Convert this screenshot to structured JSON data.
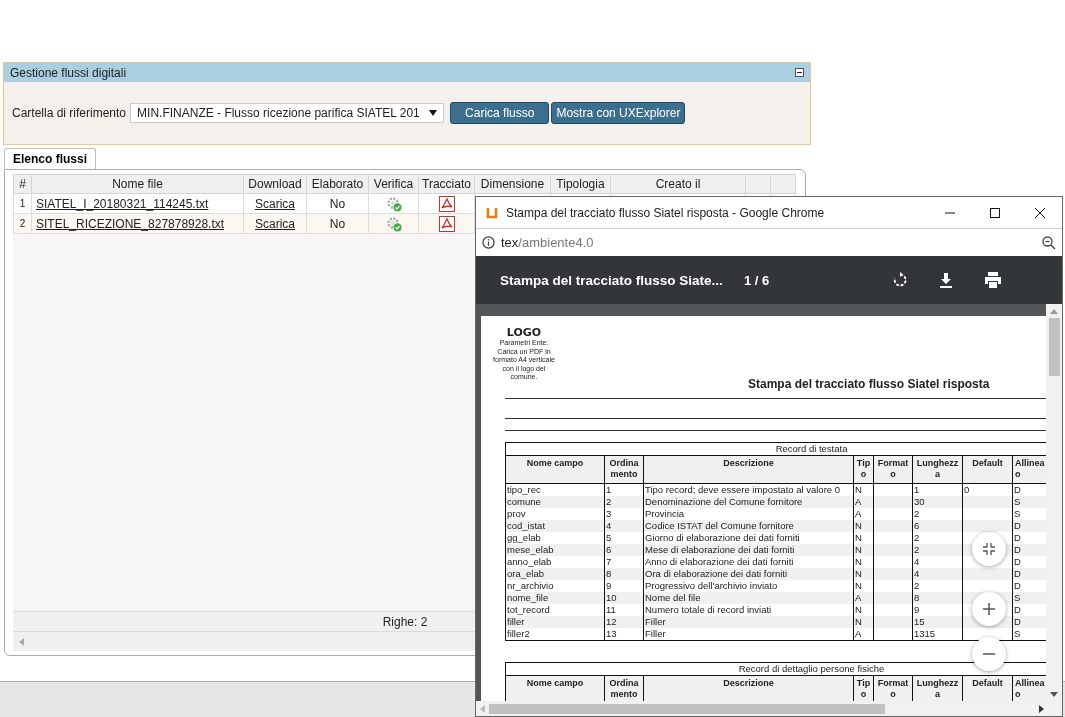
{
  "panel": {
    "title": "Gestione flussi digitali",
    "folder_label": "Cartella di riferimento",
    "folder_value": "MIN.FINANZE - Flusso ricezione parifica SIATEL 201",
    "buttons": [
      "Carica flusso",
      "Mostra con UXExplorer"
    ]
  },
  "tabs": [
    {
      "label": "Elenco flussi",
      "selected": true
    }
  ],
  "grid": {
    "columns": [
      "#",
      "Nome file",
      "Download",
      "Elaborato",
      "Verifica",
      "Tracciato",
      "Dimensione",
      "Tipologia",
      "Creato il"
    ],
    "rows": [
      {
        "number": "1",
        "file": "SIATEL_I_20180321_114245.txt",
        "download": "Scarica",
        "elaborato": "No"
      },
      {
        "number": "2",
        "file": "SITEL_RICEZIONE_827878928.txt",
        "download": "Scarica",
        "elaborato": "No"
      }
    ],
    "footer": "Righe: 2"
  },
  "popup": {
    "title": "Stampa del tracciato flusso Siatel risposta - Google Chrome",
    "url_host": "tex",
    "url_path": "/ambiente4.0",
    "pdf_title": "Stampa del tracciato flusso Siate...",
    "pages": "1 / 6",
    "document": {
      "logo": "LOGO",
      "logo_note": "Parametri Ente: Carica un PDF in formato A4 verticale con il logo del comune.",
      "title": "Stampa del tracciato flusso Siatel risposta",
      "tables": [
        {
          "caption": "Record di testata",
          "columns": [
            {
              "lines": [
                "Nome campo"
              ]
            },
            {
              "lines": [
                "Ordina",
                "mento"
              ]
            },
            {
              "lines": [
                "Descrizione"
              ]
            },
            {
              "lines": [
                "Tip",
                "o"
              ]
            },
            {
              "lines": [
                "Format",
                "o"
              ]
            },
            {
              "lines": [
                "Lunghezz",
                "a"
              ]
            },
            {
              "lines": [
                "Default"
              ]
            },
            {
              "lines": [
                "Allinea",
                "o"
              ]
            }
          ],
          "rows": [
            [
              "tipo_rec",
              "1",
              "Tipo record; deve essere impostato al valore 0",
              "N",
              "",
              "1",
              "0",
              "D"
            ],
            [
              "comune",
              "2",
              "Denominazione del Comune fornitore",
              "A",
              "",
              "30",
              "",
              "S"
            ],
            [
              "prov",
              "3",
              "Provincia",
              "A",
              "",
              "2",
              "",
              "S"
            ],
            [
              "cod_istat",
              "4",
              "Codice ISTAT del Comune fornitore",
              "N",
              "",
              "6",
              "",
              "D"
            ],
            [
              "gg_elab",
              "5",
              "Giorno di elaborazione dei dati forniti",
              "N",
              "",
              "2",
              "",
              "D"
            ],
            [
              "mese_elab",
              "6",
              "Mese di elaborazione dei dati forniti",
              "N",
              "",
              "2",
              "",
              "D"
            ],
            [
              "anno_elab",
              "7",
              "Anno di elaborazione dei dati forniti",
              "N",
              "",
              "4",
              "",
              "D"
            ],
            [
              "ora_elab",
              "8",
              "Ora di elaborazione dei dati forniti",
              "N",
              "",
              "4",
              "",
              "D"
            ],
            [
              "nr_archivio",
              "9",
              "Progressivo dell'archivio inviato",
              "N",
              "",
              "2",
              "",
              "D"
            ],
            [
              "nome_file",
              "10",
              "Nome del file",
              "A",
              "",
              "8",
              "",
              "S"
            ],
            [
              "tot_record",
              "11",
              "Numero totale di record inviati",
              "N",
              "",
              "9",
              "",
              "D"
            ],
            [
              "filler",
              "12",
              "Filler",
              "N",
              "",
              "15",
              "",
              "D"
            ],
            [
              "filler2",
              "13",
              "Filler",
              "A",
              "",
              "1315",
              "",
              "S"
            ]
          ]
        },
        {
          "caption": "Record di dettaglio persone fisiche",
          "columns": [
            {
              "lines": [
                "Nome campo"
              ]
            },
            {
              "lines": [
                "Ordina",
                "mento"
              ]
            },
            {
              "lines": [
                "Descrizione"
              ]
            },
            {
              "lines": [
                "Tip",
                "o"
              ]
            },
            {
              "lines": [
                "Format",
                "o"
              ]
            },
            {
              "lines": [
                "Lunghezz",
                "a"
              ]
            },
            {
              "lines": [
                "Default"
              ]
            },
            {
              "lines": [
                "Allinea",
                "o"
              ]
            }
          ]
        }
      ]
    }
  }
}
